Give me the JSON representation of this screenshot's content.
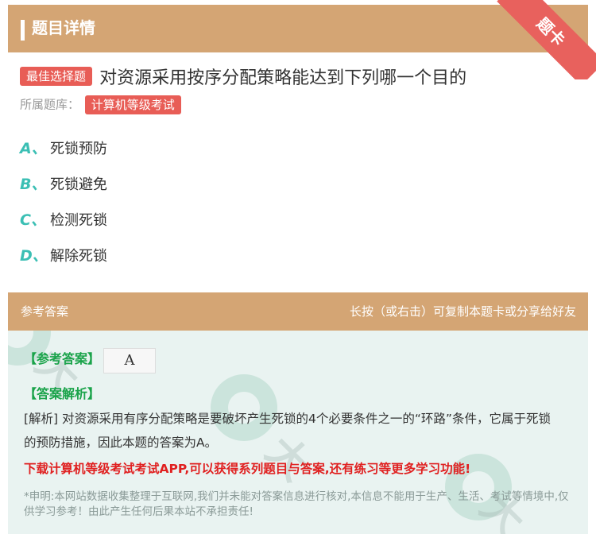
{
  "header": {
    "title": "题目详情",
    "ribbon": "题卡"
  },
  "question": {
    "type_tag": "最佳选择题",
    "text": "对资源采用按序分配策略能达到下列哪一个目的",
    "bank_label": "所属题库：",
    "bank_tag": "计算机等级考试"
  },
  "options": [
    {
      "letter": "A、",
      "text": "死锁预防"
    },
    {
      "letter": "B、",
      "text": "死锁避免"
    },
    {
      "letter": "C、",
      "text": "检测死锁"
    },
    {
      "letter": "D、",
      "text": "解除死锁"
    }
  ],
  "answer_section": {
    "left_label": "参考答案",
    "right_label": "长按（或右击）可复制本题卡或分享给好友",
    "ref_label": "【参考答案】",
    "ref_value": "A",
    "analysis_label": "【答案解析】",
    "analysis_text": "[解析] 对资源采用有序分配策略是要破坏产生死锁的4个必要条件之一的“环路”条件，它属于死锁的预防措施，因此本题的答案为A。",
    "promo": "下载计算机等级考试考试APP,可以获得系列题目与答案,还有练习等更多学习功能!",
    "disclaimer": "*申明:本网站数据收集整理于互联网,我们并未能对答案信息进行核对,本信息不能用于生产、生活、考试等情境中,仅供学习参考！由此产生任何后果本站不承担责任!"
  },
  "colors": {
    "header_bg": "#d4a574",
    "tag_red": "#e85d56",
    "option_letter": "#3bbfb4",
    "answer_green": "#1aa34a",
    "promo_red": "#e02020"
  }
}
